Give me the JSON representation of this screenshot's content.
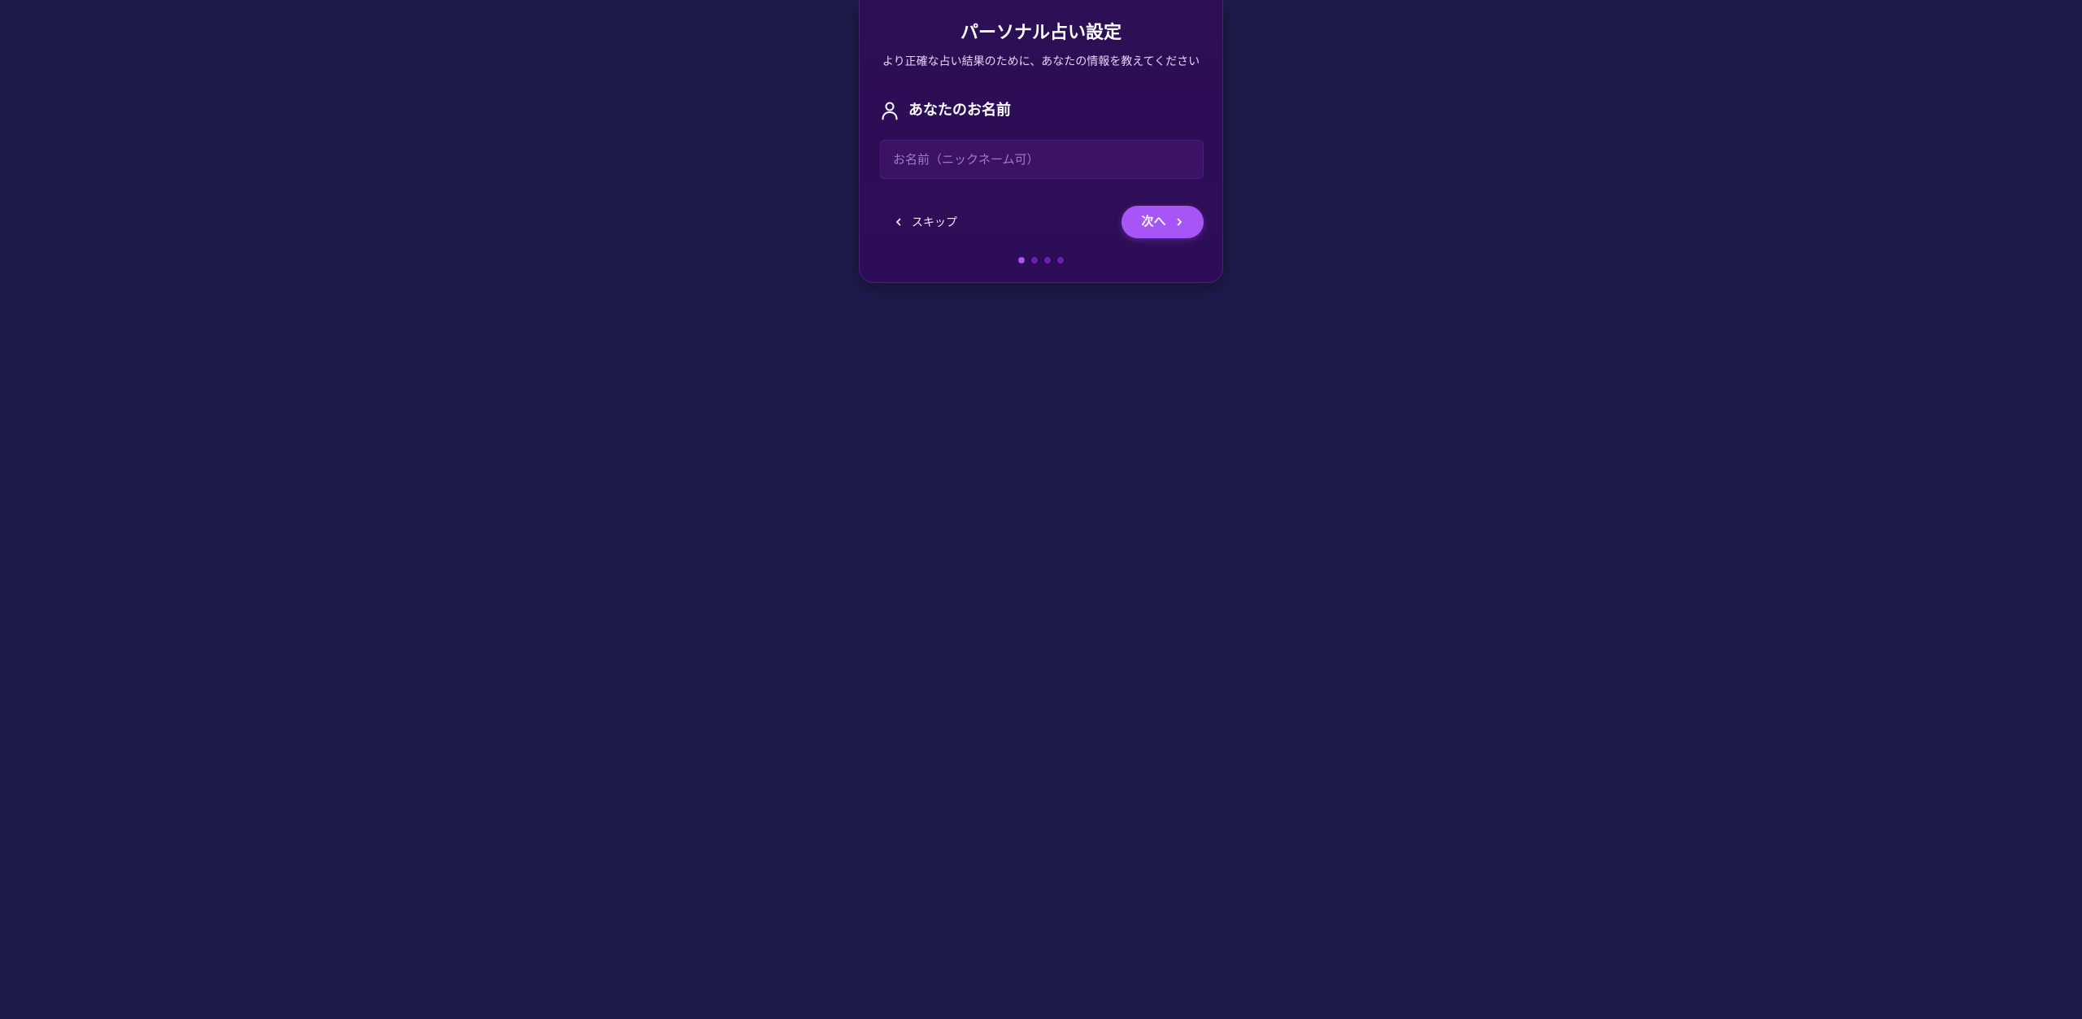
{
  "colors": {
    "page_background": "#1e1b4b",
    "card_background": "#2c0f54",
    "accent": "#a855f7",
    "input_background": "#3b1266",
    "dot_inactive": "#6b21a8"
  },
  "card": {
    "title": "パーソナル占い設定",
    "subtitle": "より正確な占い結果のために、あなたの情報を教えてください"
  },
  "section": {
    "icon": "user-icon",
    "label": "あなたのお名前"
  },
  "name_input": {
    "placeholder": "お名前（ニックネーム可）",
    "value": ""
  },
  "actions": {
    "skip_label": "スキップ",
    "skip_icon": "chevron-left-icon",
    "next_label": "次へ",
    "next_icon": "chevron-right-icon"
  },
  "progress": {
    "total_steps": 4,
    "current_step": 1
  }
}
